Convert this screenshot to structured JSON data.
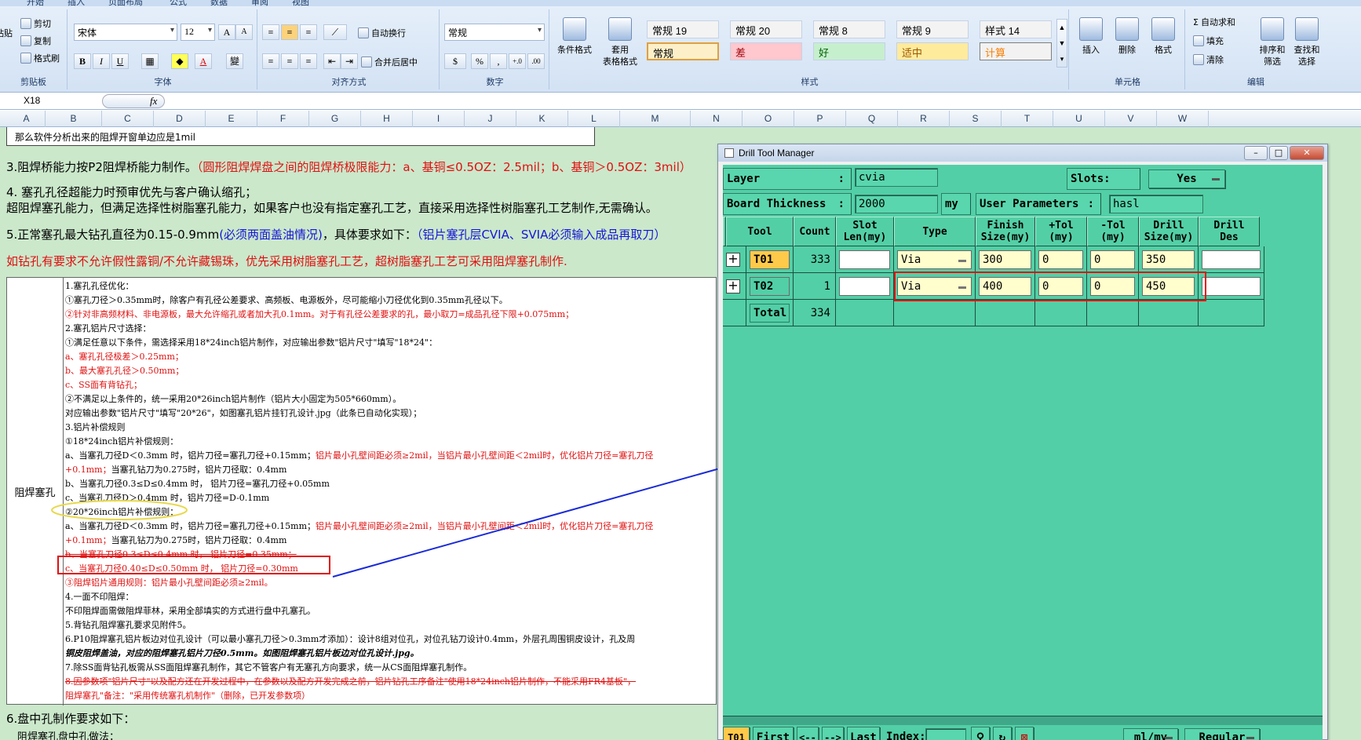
{
  "ribbon": {
    "tabs": [
      "开始",
      "插入",
      "页面布局",
      "公式",
      "数据",
      "审阅",
      "视图"
    ],
    "clipboard": {
      "cut": "剪切",
      "copy": "复制",
      "painter": "格式刷",
      "paste": "粘贴",
      "label": "剪贴板"
    },
    "font": {
      "name": "宋体",
      "size": "12",
      "bold": "B",
      "italic": "I",
      "underline": "U",
      "label": "字体"
    },
    "alignment": {
      "wrap": "自动换行",
      "merge": "合并后居中",
      "label": "对齐方式"
    },
    "number": {
      "format": "常规",
      "percent": "%",
      "comma": ",",
      "label": "数字"
    },
    "styles": {
      "conditional": "条件格式",
      "table": "套用\n表格格式",
      "label": "样式",
      "cells": [
        {
          "text": "常规 19",
          "bg": "#f3f3f3",
          "color": "#000000"
        },
        {
          "text": "常规 20",
          "bg": "#f3f3f3",
          "color": "#000000"
        },
        {
          "text": "常规 8",
          "bg": "#f3f3f3",
          "color": "#000000"
        },
        {
          "text": "常规 9",
          "bg": "#f3f3f3",
          "color": "#000000"
        },
        {
          "text": "样式 14",
          "bg": "#f3f3f3",
          "color": "#000000"
        },
        {
          "text": "常规",
          "bg": "#fdf0c9",
          "color": "#000000"
        },
        {
          "text": "差",
          "bg": "#ffc7ce",
          "color": "#9c0006"
        },
        {
          "text": "好",
          "bg": "#c6efce",
          "color": "#006100"
        },
        {
          "text": "适中",
          "bg": "#ffeb9c",
          "color": "#9c5700"
        },
        {
          "text": "计算",
          "bg": "#f2f2f2",
          "color": "#fa7d00"
        }
      ]
    },
    "cells": {
      "insert": "插入",
      "delete": "删除",
      "format": "格式",
      "label": "单元格"
    },
    "editing": {
      "autosum": "自动求和",
      "fill": "填充",
      "clear": "清除",
      "sort": "排序和\n筛选",
      "find": "查找和\n选择",
      "label": "编辑"
    }
  },
  "formula_bar": {
    "cell_ref": "X18",
    "fx": "fx"
  },
  "columns": [
    "A",
    "B",
    "C",
    "D",
    "E",
    "F",
    "G",
    "H",
    "I",
    "J",
    "K",
    "L",
    "M",
    "N",
    "O",
    "P",
    "Q",
    "R",
    "S",
    "T",
    "U",
    "V",
    "W"
  ],
  "sheet": {
    "top_note": "那么软件分析出来的阻焊开窗单边应是1mil",
    "line3": {
      "black": "3.阻焊桥能力按P2阻焊桥能力制作。",
      "red": "（圆形阻焊焊盘之间的阻焊桥极限能力：a、基铜≤0.5OZ：2.5mil；b、基铜＞0.5OZ：3mil）"
    },
    "line4a": "4. 塞孔孔径超能力时预审优先与客户确认缩孔；",
    "line4b": "超阻焊塞孔能力，但满足选择性树脂塞孔能力，如果客户也没有指定塞孔工艺，直接采用选择性树脂塞孔工艺制作,无需确认。",
    "line5": {
      "black": "5.正常塞孔最大钻孔直径为0.15-0.9mm",
      "blue1": "(必须两面盖油情况)",
      "black2": "，具体要求如下：",
      "blue2": "（铝片塞孔层CVIA、SVIA必须输入成品再取刀）"
    },
    "line_red": "如钻孔有要求不允许假性露铜/不允许藏锡珠，优先采用树脂塞孔工艺，超树脂塞孔工艺可采用阻焊塞孔制作.",
    "rule_label": "阻焊塞孔",
    "rules": [
      {
        "t": "1.塞孔孔径优化：",
        "c": ""
      },
      {
        "t": "①塞孔刀径＞0.35mm时，除客户有孔径公差要求、高频板、电源板外，尽可能缩小刀径优化到0.35mm孔径以下。",
        "c": ""
      },
      {
        "t": "②针对非高频材料、非电源板，最大允许缩孔或者加大孔0.1mm。对于有孔径公差要求的孔，最小取刀=成品孔径下限+0.075mm；",
        "c": "red"
      },
      {
        "t": "2.塞孔铝片尺寸选择：",
        "c": ""
      },
      {
        "t": "①满足任意以下条件，需选择采用18*24inch铝片制作，对应输出参数\"铝片尺寸\"填写\"18*24\"：",
        "c": ""
      },
      {
        "t": "a、塞孔孔径极差＞0.25mm；",
        "c": "red"
      },
      {
        "t": "b、最大塞孔孔径＞0.50mm；",
        "c": "red"
      },
      {
        "t": "c、SS面有背钻孔；",
        "c": "red"
      },
      {
        "t": "②不满足以上条件的，统一采用20*26inch铝片制作（铝片大小固定为505*660mm）。",
        "c": ""
      },
      {
        "t": "对应输出参数\"铝片尺寸\"填写\"20*26\"，如图塞孔铝片挂钉孔设计.jpg（此条已自动化实现）；",
        "c": ""
      },
      {
        "t": "3.铝片补偿规则",
        "c": ""
      },
      {
        "t": "①18*24inch铝片补偿规则：",
        "c": ""
      },
      {
        "t": "a、当塞孔刀径D＜0.3mm 时，铝片刀径=塞孔刀径+0.15mm；铝片最小孔壁间距必须≥2mil，当铝片最小孔壁间距＜2mil时，优化铝片刀径=塞孔刀径",
        "c": "mix"
      },
      {
        "t": "+0.1mm；当塞孔钻刀为0.275时，铝片刀径取：0.4mm",
        "c": "mix2"
      },
      {
        "t": "b、当塞孔刀径0.3≤D≤0.4mm 时， 铝片刀径=塞孔刀径+0.05mm",
        "c": ""
      },
      {
        "t": "c、当塞孔刀径D＞0.4mm 时，铝片刀径=D-0.1mm",
        "c": ""
      },
      {
        "t": "②20*26inch铝片补偿规则：",
        "c": ""
      },
      {
        "t": "a、当塞孔刀径D＜0.3mm 时，铝片刀径=塞孔刀径+0.15mm；铝片最小孔壁间距必须≥2mil，当铝片最小孔壁间距＜2mil时，优化铝片刀径=塞孔刀径",
        "c": "mix"
      },
      {
        "t": "+0.1mm；当塞孔钻刀为0.275时，铝片刀径取：0.4mm",
        "c": "mix2"
      },
      {
        "t": "b、当塞孔刀径0.3≤D≤0.4mm 时， 铝片刀径=0.35mm；",
        "c": "red strike"
      },
      {
        "t": "c、当塞孔刀径0.40≤D≤0.50mm 时， 铝片刀径=0.30mm",
        "c": "red"
      },
      {
        "t": "③阻焊铝片通用规则：铝片最小孔壁间距必须≥2mil。",
        "c": "red"
      },
      {
        "t": "4.一面不印阻焊：",
        "c": ""
      },
      {
        "t": "不印阻焊面需做阻焊菲林，采用全部填实的方式进行盘中孔塞孔。",
        "c": ""
      },
      {
        "t": "5.背钻孔阻焊塞孔要求见附件5。",
        "c": ""
      },
      {
        "t": "6.P10阻焊塞孔铝片板边对位孔设计（可以最小塞孔刀径＞0.3mm才添加）：设计8组对位孔，对位孔钻刀设计0.4mm，外层孔周围铜皮设计，孔及周",
        "c": ""
      },
      {
        "t": "铜皮阻焊盖油，对应的阻焊塞孔铝片刀径0.5mm。如图阻焊塞孔铝片板边对位孔设计.jpg。",
        "c": "bold"
      },
      {
        "t": "7.除SS面背钻孔板需从SS面阻焊塞孔制作，其它不管客户有无塞孔方向要求，统一从CS面阻焊塞孔制作。",
        "c": ""
      },
      {
        "t": "8.因参数项\"铝片尺寸\"以及配方还在开发过程中，在参数以及配方开发完成之前，铝片钻孔工序备注\"使用18*24inch铝片制作，不能采用FR4基板\"，",
        "c": "red strike"
      },
      {
        "t": "阻焊塞孔\"备注：\"采用传统塞孔机制作\"（删除，已开发参数项）",
        "c": "red"
      }
    ],
    "line6": "6.盘中孔制作要求如下：",
    "line6b": "阻焊塞孔盘中孔做法："
  },
  "dtm": {
    "title": "Drill Tool Manager",
    "layer_label": "Layer",
    "layer_value": "cvia",
    "slots_label": "Slots:",
    "slots_value": "Yes",
    "thickness_label": "Board Thickness",
    "thickness_value": "2000",
    "thickness_unit": "my",
    "user_params_label": "User Parameters",
    "user_params_value": "hasl",
    "headers": [
      "Tool",
      "Count",
      "Slot\nLen(my)",
      "Type",
      "Finish\nSize(my)",
      "+Tol\n(my)",
      "-Tol\n(my)",
      "Drill\nSize(my)",
      "Drill\nDes"
    ],
    "rows": [
      {
        "tool": "T01",
        "count": "333",
        "slot": "",
        "type": "Via",
        "finish": "300",
        "ptol": "0",
        "ntol": "0",
        "drill": "350",
        "des": ""
      },
      {
        "tool": "T02",
        "count": "1",
        "slot": "",
        "type": "Via",
        "finish": "400",
        "ptol": "0",
        "ntol": "0",
        "drill": "450",
        "des": ""
      }
    ],
    "total_label": "Total",
    "total_count": "334",
    "bottom": {
      "current": "T01",
      "first": "First",
      "prev": "<--",
      "next": "-->",
      "last": "Last",
      "index_label": "Index:",
      "index_value": "",
      "units": "ml/my",
      "mode": "Regular"
    }
  },
  "colors": {
    "sheet_bg": "#cbe8cb",
    "dtm_bg": "#52cfa6",
    "annotation_red": "#e01010",
    "arrow_blue": "#1a2bd6",
    "highlight_yellow": "#e8d84a"
  }
}
